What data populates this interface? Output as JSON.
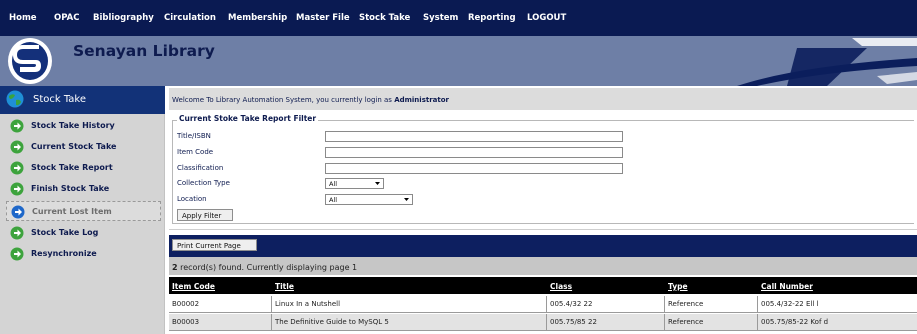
{
  "topnav": {
    "items": [
      "Home",
      "OPAC",
      "Bibliography",
      "Circulation",
      "Membership",
      "Master File",
      "Stock Take",
      "System",
      "Reporting",
      "LOGOUT"
    ]
  },
  "banner": {
    "title": "Senayan Library"
  },
  "sidebar": {
    "title": "Stock Take",
    "items": [
      {
        "label": "Stock Take History",
        "active": false
      },
      {
        "label": "Current Stock Take",
        "active": false
      },
      {
        "label": "Stock Take Report",
        "active": false
      },
      {
        "label": "Finish Stock Take",
        "active": false
      },
      {
        "label": "Current Lost Item",
        "active": true
      },
      {
        "label": "Stock Take Log",
        "active": false
      },
      {
        "label": "Resynchronize",
        "active": false
      }
    ]
  },
  "welcome": {
    "text": "Welcome To Library Automation System, you currently login as ",
    "user": "Administrator"
  },
  "filter": {
    "legend": "Current Stoke Take Report Filter",
    "title_isbn_label": "Title/ISBN",
    "title_isbn_value": "",
    "item_code_label": "Item Code",
    "item_code_value": "",
    "classification_label": "Classification",
    "classification_value": "",
    "collection_type_label": "Collection Type",
    "collection_type_value": "All",
    "location_label": "Location",
    "location_value": "All",
    "apply_label": "Apply Filter"
  },
  "print": {
    "label": "Print Current Page"
  },
  "records": {
    "count": "2",
    "text": " record(s) found. Currently displaying page 1"
  },
  "table": {
    "headers": [
      "Item Code",
      "Title",
      "Class",
      "Type",
      "Call Number"
    ],
    "rows": [
      [
        "B00002",
        "Linux In a Nutshell",
        "005.4/32 22",
        "Reference",
        "005.4/32-22 Ell l"
      ],
      [
        "B00003",
        "The Definitive Guide to MySQL 5",
        "005.75/85 22",
        "Reference",
        "005.75/85-22 Kof d"
      ]
    ]
  },
  "colors": {
    "topnav": "#0a1a52",
    "banner": "#6e7fa6",
    "sidebar_header": "#123278",
    "sidebar_bg": "#d4d4d4",
    "bullet_green": "#3da33d",
    "bullet_blue": "#1e67c9",
    "print_bar": "#0d1f60",
    "records_bar": "#c6c6c6",
    "table_header": "#000000"
  },
  "icons": {
    "logo": "senayan-s-logo",
    "sidebar": "globe-icon",
    "bullet": "arrow-right-circle-icon",
    "select": "chevron-down-icon"
  }
}
